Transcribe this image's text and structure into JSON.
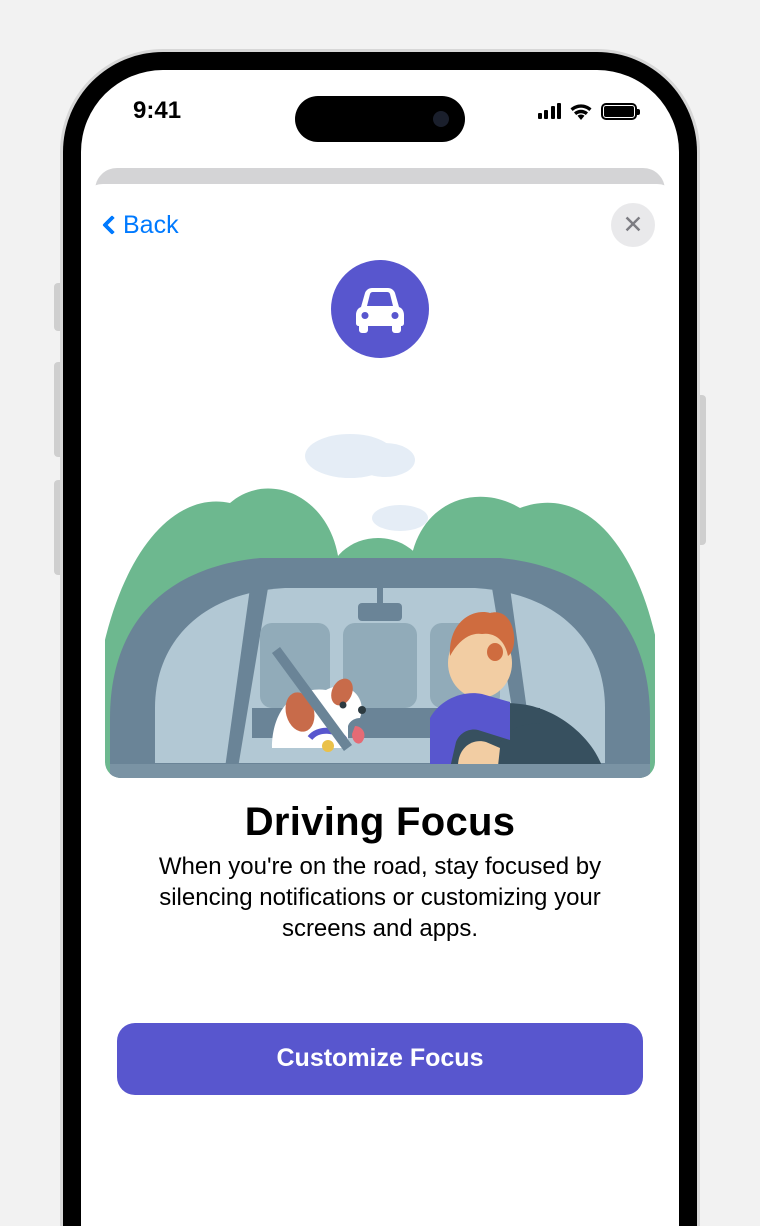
{
  "status_bar": {
    "time": "9:41"
  },
  "nav": {
    "back_label": "Back"
  },
  "header": {
    "icon_name": "car-icon"
  },
  "content": {
    "title": "Driving Focus",
    "description": "When you're on the road, stay focused by silencing notifications or customizing your screens and apps."
  },
  "actions": {
    "primary_label": "Customize Focus"
  },
  "colors": {
    "accent": "#5856ce",
    "link": "#007aff"
  }
}
